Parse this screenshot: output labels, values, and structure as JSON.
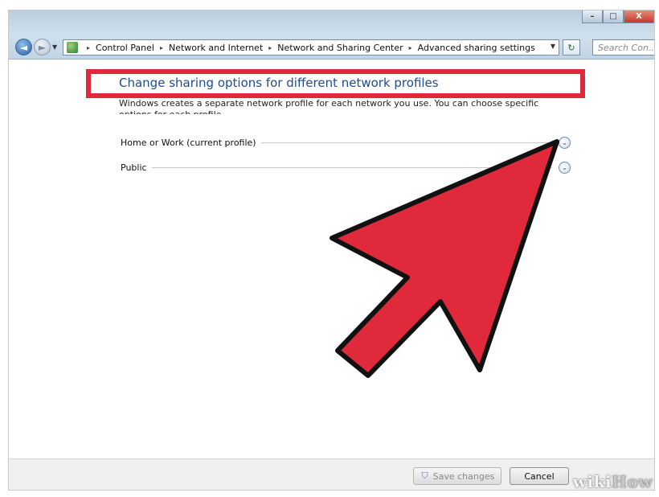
{
  "window": {
    "buttons": [
      "–",
      "□",
      "X"
    ]
  },
  "nav": {
    "back_glyph": "◄",
    "forward_glyph": "►",
    "dropdown_glyph": "▼",
    "refresh_glyph": "↻"
  },
  "breadcrumb": {
    "separator": "▸",
    "items": [
      "Control Panel",
      "Network and Internet",
      "Network and Sharing Center",
      "Advanced sharing settings"
    ]
  },
  "search": {
    "placeholder": "Search Con..."
  },
  "page": {
    "title": "Change sharing options for different network profiles",
    "description": "Windows creates a separate network profile for each network you use. You can choose specific options for each profile."
  },
  "profiles": [
    {
      "label": "Home or Work (current profile)",
      "expanded": false
    },
    {
      "label": "Public",
      "expanded": false
    }
  ],
  "expand_glyph": "⌄",
  "footer": {
    "save_label": "Save changes",
    "cancel_label": "Cancel",
    "save_icon": "shield-icon"
  },
  "watermark": {
    "wiki": "wiki",
    "how": "How"
  },
  "colors": {
    "highlight": "#e02a3c",
    "arrow_fill": "#e02a3c",
    "title_blue": "#1e4d8c"
  }
}
